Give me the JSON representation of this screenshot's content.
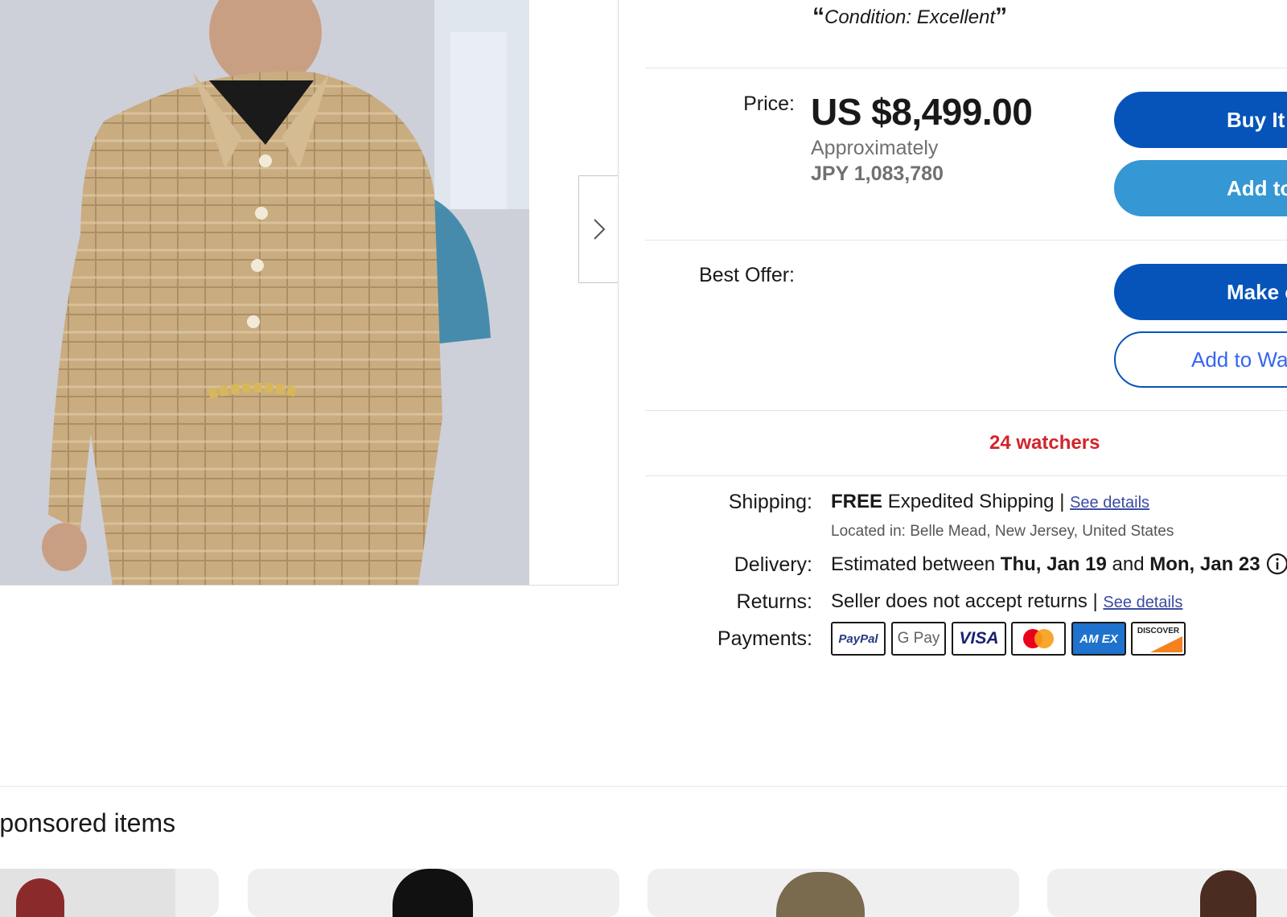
{
  "condition": {
    "text": "Condition: Excellent",
    "open_quote": "“",
    "close_quote": "”"
  },
  "price": {
    "label": "Price:",
    "amount": "US $8,499.00",
    "approx_label": "Approximately",
    "converted": "JPY 1,083,780"
  },
  "buttons": {
    "buy_now": "Buy It Now",
    "add_to_cart": "Add to cart",
    "make_offer": "Make offer",
    "add_to_watchlist": "Add to Watchlist"
  },
  "best_offer": {
    "label": "Best Offer:"
  },
  "watchers": "24 watchers",
  "shipping": {
    "label": "Shipping:",
    "free": "FREE",
    "method": "Expedited Shipping",
    "divider": "|",
    "see_details": "See details",
    "located": "Located in: Belle Mead, New Jersey, United States"
  },
  "delivery": {
    "label": "Delivery:",
    "prefix": "Estimated between",
    "start": "Thu, Jan 19",
    "and": "and",
    "end": "Mon, Jan 23"
  },
  "returns": {
    "label": "Returns:",
    "text": "Seller does not accept returns",
    "divider": "|",
    "see_details": "See details"
  },
  "payments": {
    "label": "Payments:",
    "methods": [
      "PayPal",
      "G Pay",
      "VISA",
      "Mastercard",
      "AM EX",
      "DISCOVER"
    ]
  },
  "sponsored": {
    "title": "Sponsored items"
  },
  "colors": {
    "primary_blue": "#0654ba",
    "secondary_blue": "#3597d3",
    "watchers_red": "#d1242b",
    "link_blue": "#3a4ba0"
  }
}
